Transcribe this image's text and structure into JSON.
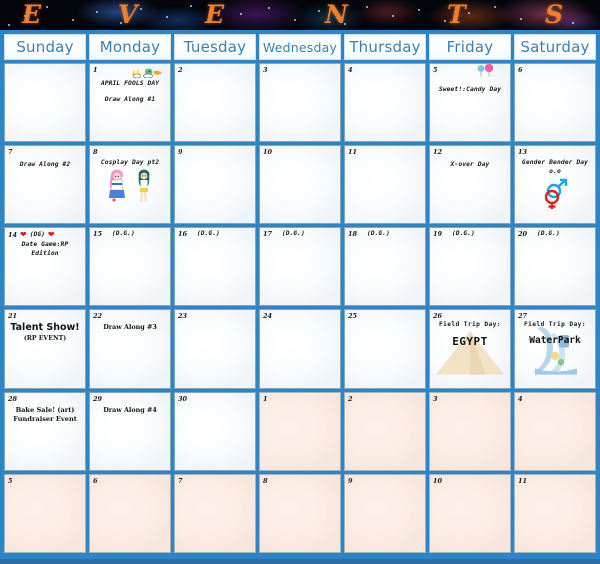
{
  "banner": {
    "letters": [
      "E",
      "V",
      "E",
      "N",
      "T",
      "S"
    ],
    "title": "EVENTS",
    "text_color": "#f07f2c",
    "background_color": "#05060c"
  },
  "theme": {
    "frame_color": "#2f84c6",
    "weekday_text_color": "#3a7fb5",
    "cell_border_color": "#7ea8bd",
    "next_month_cell_color": "#fbece4"
  },
  "weekdays": [
    "Sunday",
    "Monday",
    "Tuesday",
    "Wednesday",
    "Thursday",
    "Friday",
    "Saturday"
  ],
  "weeks": [
    [
      {
        "day": "",
        "events": []
      },
      {
        "day": "1",
        "events": [
          "APRIL FOOLS DAY",
          "Draw Along #1"
        ],
        "icons": [
          "chick-icon",
          "bird-icon"
        ]
      },
      {
        "day": "2",
        "events": []
      },
      {
        "day": "3",
        "events": []
      },
      {
        "day": "4",
        "events": []
      },
      {
        "day": "5",
        "events": [
          "Sweet!:Candy Day"
        ],
        "icons": [
          "lollipop-blue-icon",
          "lollipop-pink-icon"
        ]
      },
      {
        "day": "6",
        "events": []
      }
    ],
    [
      {
        "day": "7",
        "events": [
          "Draw Along #2"
        ]
      },
      {
        "day": "8",
        "events": [
          "Cosplay Day pt2"
        ],
        "icons": [
          "cosplay-girl-pink-icon",
          "cosplay-girl-green-icon"
        ]
      },
      {
        "day": "9",
        "events": []
      },
      {
        "day": "10",
        "events": []
      },
      {
        "day": "11",
        "events": []
      },
      {
        "day": "12",
        "events": [
          "X-over Day"
        ]
      },
      {
        "day": "13",
        "events": [
          "Gender Bender Day o.o"
        ],
        "icons": [
          "gender-symbols-icon"
        ]
      }
    ],
    [
      {
        "day": "14",
        "events": [
          "(DG)",
          "Date Game:RP Edition"
        ],
        "icons": [
          "heart-icon",
          "heart-icon"
        ]
      },
      {
        "day": "15",
        "events": [
          "(D.G.)"
        ]
      },
      {
        "day": "16",
        "events": [
          "(D.G.)"
        ]
      },
      {
        "day": "17",
        "events": [
          "(D.G.)"
        ]
      },
      {
        "day": "18",
        "events": [
          "(D.G.)"
        ]
      },
      {
        "day": "19",
        "events": [
          "(D.G.)"
        ]
      },
      {
        "day": "20",
        "events": [
          "(D.G.)"
        ]
      }
    ],
    [
      {
        "day": "21",
        "events": [
          "Talent Show!",
          "(RP EVENT)"
        ]
      },
      {
        "day": "22",
        "events": [
          "Draw Along #3"
        ]
      },
      {
        "day": "23",
        "events": []
      },
      {
        "day": "24",
        "events": []
      },
      {
        "day": "25",
        "events": []
      },
      {
        "day": "26",
        "events": [
          "Field Trip Day:",
          "EGYPT"
        ],
        "icons": [
          "pyramid-icon"
        ]
      },
      {
        "day": "27",
        "events": [
          "Field Trip Day:",
          "WaterPark"
        ],
        "icons": [
          "waterslide-icon"
        ]
      }
    ],
    [
      {
        "day": "28",
        "events": [
          "Bake Sale! (art)",
          "Fundraiser Event"
        ]
      },
      {
        "day": "29",
        "events": [
          "Draw Along #4"
        ]
      },
      {
        "day": "30",
        "events": []
      },
      {
        "day": "1",
        "events": [],
        "next_month": true
      },
      {
        "day": "2",
        "events": [],
        "next_month": true
      },
      {
        "day": "3",
        "events": [],
        "next_month": true
      },
      {
        "day": "4",
        "events": [],
        "next_month": true
      }
    ],
    [
      {
        "day": "5",
        "events": [],
        "next_month": true
      },
      {
        "day": "6",
        "events": [],
        "next_month": true
      },
      {
        "day": "7",
        "events": [],
        "next_month": true
      },
      {
        "day": "8",
        "events": [],
        "next_month": true
      },
      {
        "day": "9",
        "events": [],
        "next_month": true
      },
      {
        "day": "10",
        "events": [],
        "next_month": true
      },
      {
        "day": "11",
        "events": [],
        "next_month": true
      }
    ]
  ]
}
